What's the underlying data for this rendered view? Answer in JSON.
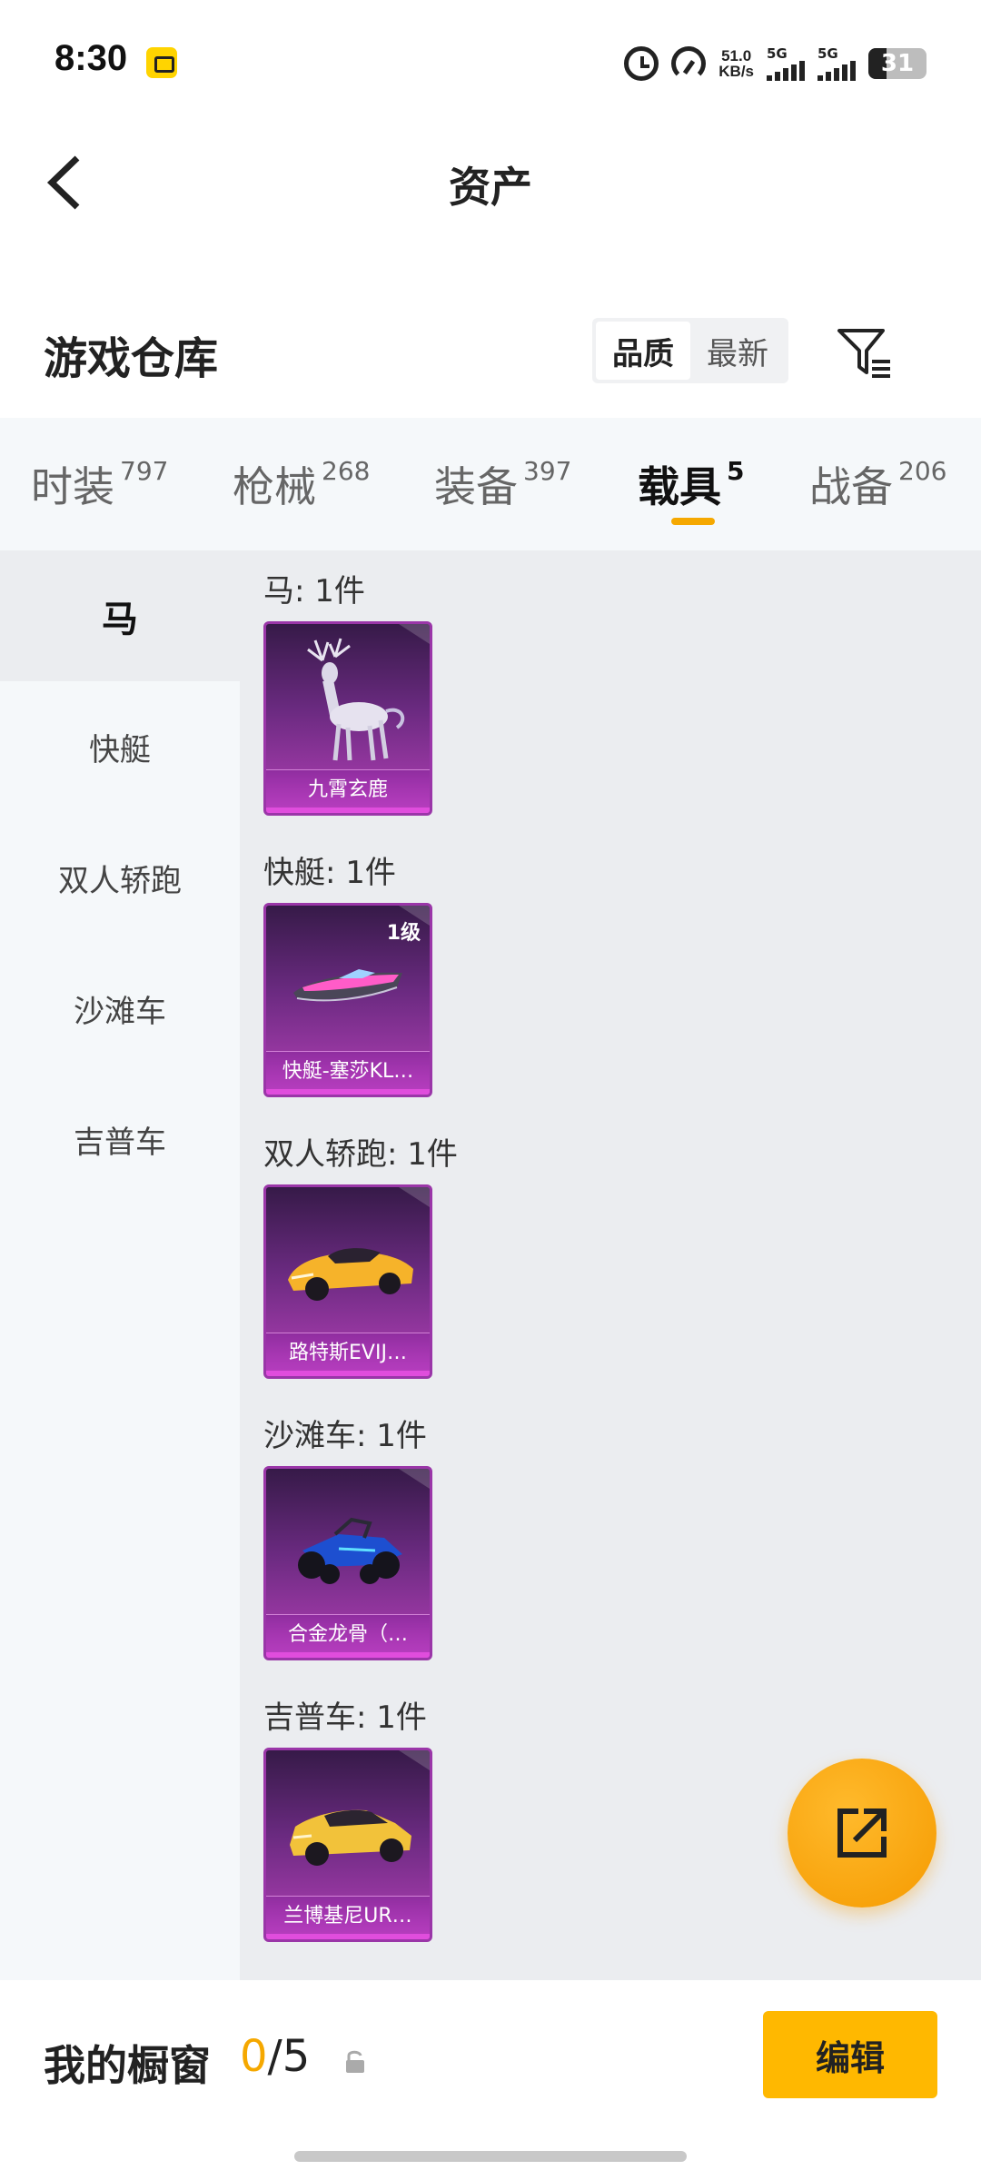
{
  "status_bar": {
    "time": "8:30",
    "net_speed_value": "51.0",
    "net_speed_unit": "KB/s",
    "sim1": "5G",
    "sim2": "5G",
    "battery": "31",
    "battery_level_percent": 31,
    "icons": [
      "app-notification-icon",
      "alarm-icon",
      "speedometer-icon",
      "signal-icon",
      "battery-icon"
    ]
  },
  "header": {
    "title": "资产",
    "back_icon": "back-arrow-icon"
  },
  "warehouse": {
    "title": "游戏仓库",
    "sort_options": [
      "品质",
      "最新"
    ],
    "sort_selected": "品质",
    "filter_icon": "filter-icon"
  },
  "tabs": [
    {
      "label": "时装",
      "count": "797"
    },
    {
      "label": "枪械",
      "count": "268"
    },
    {
      "label": "装备",
      "count": "397"
    },
    {
      "label": "载具",
      "count": "5"
    },
    {
      "label": "战备",
      "count": "206"
    }
  ],
  "active_tab": "载具",
  "categories": [
    {
      "label": "马"
    },
    {
      "label": "快艇"
    },
    {
      "label": "双人轿跑"
    },
    {
      "label": "沙滩车"
    },
    {
      "label": "吉普车"
    }
  ],
  "active_category": "马",
  "groups": [
    {
      "title": "马: 1件",
      "item": {
        "name": "九霄玄鹿",
        "level": "",
        "art": "deer"
      }
    },
    {
      "title": "快艇: 1件",
      "item": {
        "name": "快艇-塞莎KL…",
        "level": "1级",
        "art": "boat"
      }
    },
    {
      "title": "双人轿跑: 1件",
      "item": {
        "name": "路特斯EVIJ…",
        "level": "",
        "art": "sportscar"
      }
    },
    {
      "title": "沙滩车: 1件",
      "item": {
        "name": "合金龙骨（…",
        "level": "",
        "art": "buggy"
      }
    },
    {
      "title": "吉普车: 1件",
      "item": {
        "name": "兰博基尼UR…",
        "level": "",
        "art": "suv"
      }
    }
  ],
  "fab_icon": "share-icon",
  "bottom_bar": {
    "label": "我的橱窗",
    "current": "0",
    "total": "5",
    "lock_icon": "lock-icon",
    "edit_label": "编辑"
  },
  "colors": {
    "accent": "#f5a800",
    "card_purple": "#9a36a8",
    "panel_bg": "#ebedf0",
    "nav_bg": "#f5f8fa"
  }
}
